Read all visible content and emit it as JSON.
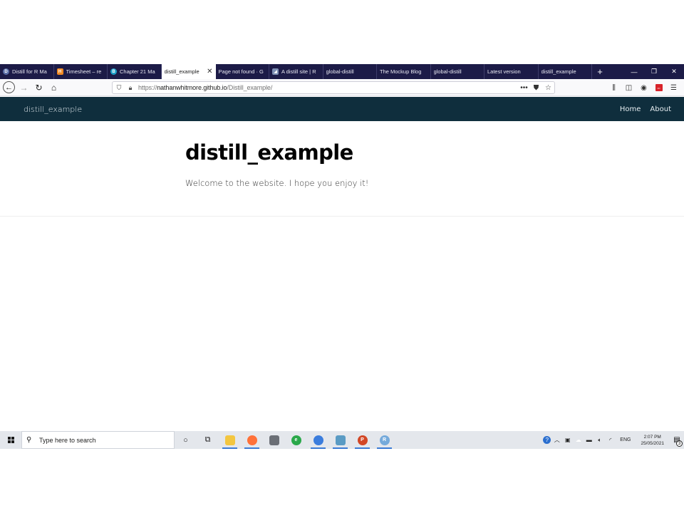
{
  "browser": {
    "tabs": [
      {
        "label": "Distill for R Ma",
        "favicon_color": "#5b6fa8",
        "favicon_glyph": "D",
        "round": true
      },
      {
        "label": "Timesheet – re",
        "favicon_color": "#f08a24",
        "favicon_glyph": "H",
        "round": false
      },
      {
        "label": "Chapter 21 Ma",
        "favicon_color": "#1ea0c8",
        "favicon_glyph": "B",
        "round": true
      },
      {
        "label": "distill_example",
        "active": true
      },
      {
        "label": "Page not found · G"
      },
      {
        "label": "A distill site | R",
        "favicon_color": "#7d8fb3",
        "favicon_glyph": "◢",
        "round": false
      },
      {
        "label": "global-distill"
      },
      {
        "label": "The Mockup Blog"
      },
      {
        "label": "global-distill"
      },
      {
        "label": "Latest version"
      },
      {
        "label": "distill_example"
      }
    ],
    "url": {
      "scheme": "https://",
      "host": "nathanwhitmore.github.io",
      "path": "/Distill_example/"
    }
  },
  "site": {
    "title": "distill_example",
    "nav": [
      "Home",
      "About"
    ],
    "heading": "distill_example",
    "intro": "Welcome to the website. I hope you enjoy it!"
  },
  "taskbar": {
    "search_placeholder": "Type here to search",
    "language": "ENG",
    "time": "2:07 PM",
    "date": "25/05/2021",
    "notifications": "3"
  }
}
